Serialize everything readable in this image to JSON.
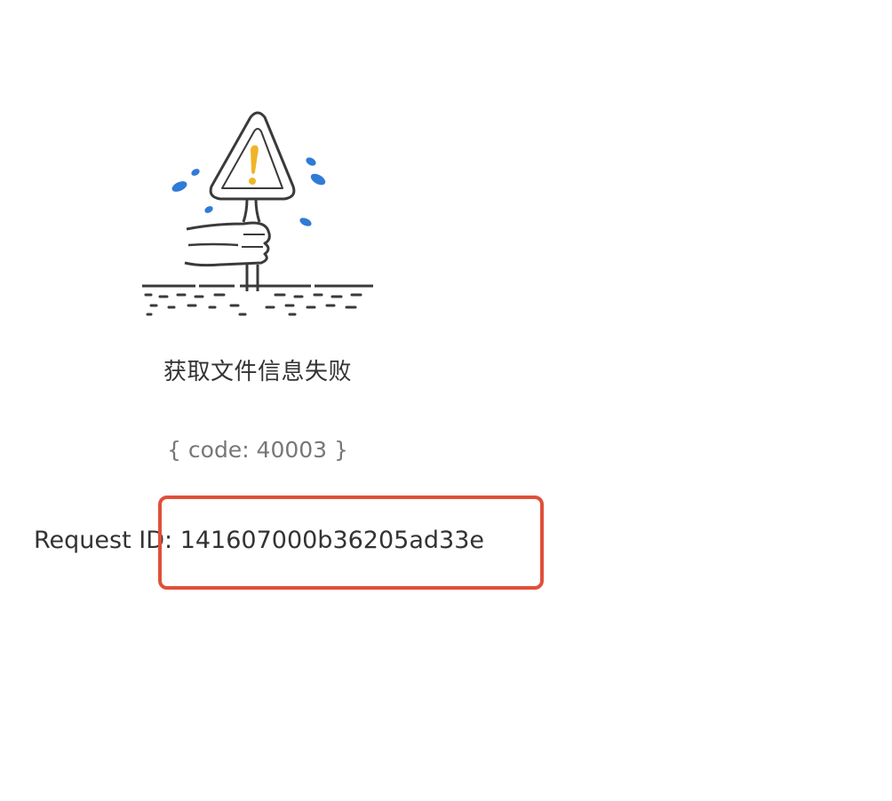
{
  "illustration": {
    "icon": "warning-trowel-illustration",
    "accent_color": "#f0b429",
    "droplet_color": "#2f7bd6"
  },
  "error": {
    "message": "获取文件信息失败",
    "code_text": "{ code: 40003 }"
  },
  "request": {
    "label": "Request ID:",
    "id": "141607000b36205ad33e"
  },
  "annotation": {
    "box_color": "#e0503a"
  }
}
